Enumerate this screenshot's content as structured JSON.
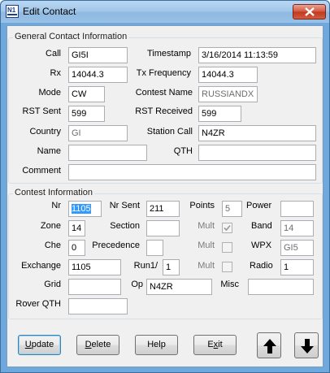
{
  "window": {
    "title": "Edit Contact",
    "close_icon": "close-icon"
  },
  "general": {
    "title": "General Contact Information",
    "call": {
      "label": "Call",
      "value": "GI5I"
    },
    "timestamp": {
      "label": "Timestamp",
      "value": "3/16/2014 11:13:59"
    },
    "rx": {
      "label": "Rx",
      "value": "14044.3"
    },
    "tx_frequency": {
      "label": "Tx Frequency",
      "value": "14044.3"
    },
    "mode": {
      "label": "Mode",
      "value": "CW"
    },
    "contest_name": {
      "label": "Contest Name",
      "value": "RUSSIANDX"
    },
    "rst_sent": {
      "label": "RST Sent",
      "value": "599"
    },
    "rst_received": {
      "label": "RST Received",
      "value": "599"
    },
    "country": {
      "label": "Country",
      "value": "GI"
    },
    "station_call": {
      "label": "Station Call",
      "value": "N4ZR"
    },
    "name": {
      "label": "Name",
      "value": ""
    },
    "qth": {
      "label": "QTH",
      "value": ""
    },
    "comment": {
      "label": "Comment",
      "value": ""
    }
  },
  "contest": {
    "title": "Contest Information",
    "nr": {
      "label": "Nr",
      "value": "1105"
    },
    "nr_sent": {
      "label": "Nr Sent",
      "value": "211"
    },
    "points": {
      "label": "Points",
      "value": "5"
    },
    "power": {
      "label": "Power",
      "value": ""
    },
    "zone": {
      "label": "Zone",
      "value": "14"
    },
    "section": {
      "label": "Section",
      "value": ""
    },
    "mult1": {
      "label": "Mult",
      "checked": true
    },
    "band": {
      "label": "Band",
      "value": "14"
    },
    "che": {
      "label": "Che",
      "value": "0"
    },
    "precedence": {
      "label": "Precedence",
      "value": ""
    },
    "mult2": {
      "label": "Mult",
      "checked": false
    },
    "wpx": {
      "label": "WPX",
      "value": "GI5"
    },
    "exchange": {
      "label": "Exchange",
      "value": "1105"
    },
    "run1": {
      "label": "Run1/",
      "value": "1"
    },
    "mult3": {
      "label": "Mult",
      "checked": false
    },
    "radio": {
      "label": "Radio",
      "value": "1"
    },
    "grid": {
      "label": "Grid",
      "value": ""
    },
    "op": {
      "label": "Op",
      "value": "N4ZR"
    },
    "misc": {
      "label": "Misc",
      "value": ""
    },
    "rover_qth": {
      "label": "Rover QTH",
      "value": ""
    }
  },
  "buttons": {
    "update": {
      "pre": "",
      "ul": "U",
      "post": "pdate"
    },
    "delete": {
      "pre": "",
      "ul": "D",
      "post": "elete"
    },
    "help": {
      "label": "Help"
    },
    "exit": {
      "pre": "E",
      "ul": "x",
      "post": "it"
    },
    "up_icon": "arrow-up-icon",
    "down_icon": "arrow-down-icon"
  },
  "colors": {
    "titlebar": "#a4c8ea",
    "close": "#c0381f",
    "selection": "#3399ff"
  }
}
